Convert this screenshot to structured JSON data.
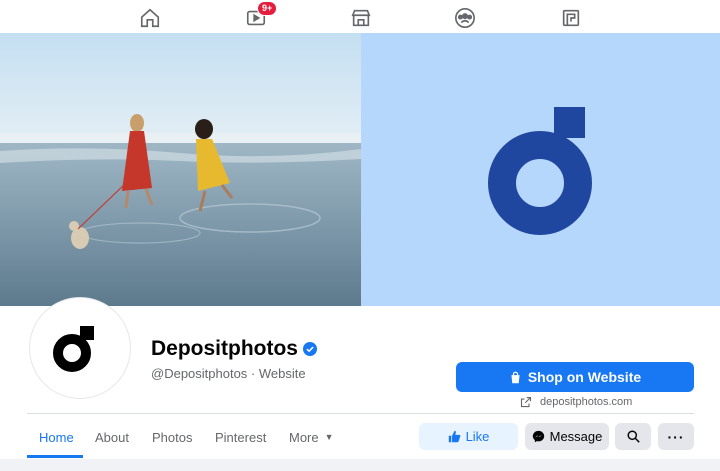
{
  "topnav": {
    "items": [
      {
        "name": "home-icon"
      },
      {
        "name": "watch-icon",
        "badge": "9+"
      },
      {
        "name": "marketplace-icon"
      },
      {
        "name": "groups-icon"
      },
      {
        "name": "gaming-icon"
      }
    ]
  },
  "cover": {
    "photo_description_icon": "beach-photo",
    "brand_bg": "#b5d7fb",
    "logo_color": "#1f47a0"
  },
  "profile": {
    "name": "Depositphotos",
    "handle": "@Depositphotos · Website",
    "verified_icon": "verified-badge-icon"
  },
  "shop": {
    "label": "Shop on Website",
    "link": "depositphotos.com"
  },
  "tabs": [
    {
      "label": "Home",
      "active": true
    },
    {
      "label": "About"
    },
    {
      "label": "Photos"
    },
    {
      "label": "Pinterest"
    },
    {
      "label": "More"
    }
  ],
  "actions": {
    "like": "Like",
    "message": "Message",
    "more": "···"
  },
  "colors": {
    "accent": "#1877f2",
    "badge": "#e41e3f"
  }
}
